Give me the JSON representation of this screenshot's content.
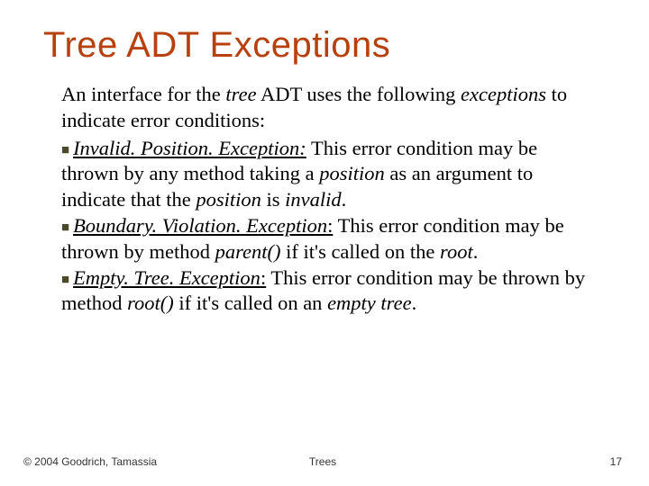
{
  "title": "Tree ADT Exceptions",
  "intro": {
    "p1": "An interface for the ",
    "tree": "tree",
    "p2": " ADT uses the following ",
    "exceptions": "exceptions",
    "p3": " to indicate error conditions:"
  },
  "bullets": [
    {
      "name_i": "Invalid. Position. Exception:",
      "t1": " This error condition may be thrown by any method taking a ",
      "i1": "position",
      "t2": " as an argument to indicate that the ",
      "i2": "position",
      "t3": " is ",
      "i3": "invalid",
      "t4": "."
    },
    {
      "name_i": "Boundary. Violation. Exception",
      "col": ":",
      "t1": " This error condition may be thrown by method ",
      "i1": "parent()",
      "t2": " if it's called on the ",
      "i2": "root",
      "t3": ".",
      "i3": "",
      "t4": ""
    },
    {
      "name_i": "Empty. Tree. Exception",
      "col": ":",
      "t1": " This error condition may be thrown by method ",
      "i1": "root()",
      "t2": " if it's called on an ",
      "i2": "empty tree",
      "t3": ".",
      "i3": "",
      "t4": ""
    }
  ],
  "footer": {
    "copyright": "© 2004 Goodrich, Tamassia",
    "topic": "Trees",
    "page": "17"
  }
}
